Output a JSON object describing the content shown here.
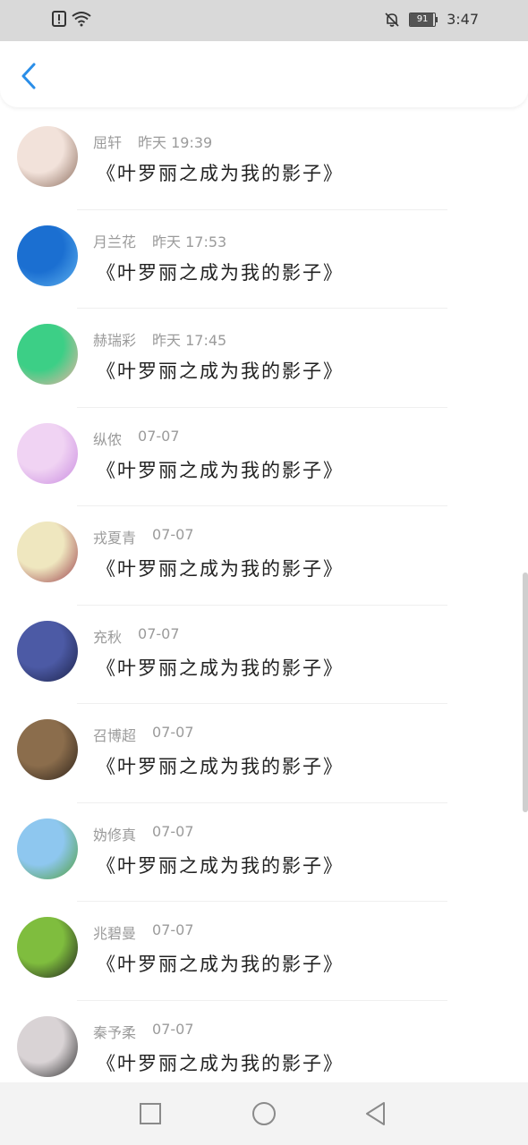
{
  "status_bar": {
    "time": "3:47",
    "battery": "91",
    "icons": [
      "alert-icon",
      "wifi-icon",
      "bell-off-icon",
      "battery-icon"
    ]
  },
  "header": {
    "back_icon": "chevron-left-icon",
    "accent": "#2a8ee8"
  },
  "items": [
    {
      "name": "屈轩",
      "time": "昨天 19:39",
      "message": "《叶罗丽之成为我的影子》",
      "avatar_colors": [
        "#f2e2da",
        "#8a6b5c"
      ]
    },
    {
      "name": "月兰花",
      "time": "昨天 17:53",
      "message": "《叶罗丽之成为我的影子》",
      "avatar_colors": [
        "#1b6fd1",
        "#5fb2ef"
      ]
    },
    {
      "name": "赫瑞彩",
      "time": "昨天 17:45",
      "message": "《叶罗丽之成为我的影子》",
      "avatar_colors": [
        "#3ccf86",
        "#f3b1a2"
      ]
    },
    {
      "name": "纵侬",
      "time": "07-07",
      "message": "《叶罗丽之成为我的影子》",
      "avatar_colors": [
        "#f0d3f3",
        "#c98ae0"
      ]
    },
    {
      "name": "戎夏青",
      "time": "07-07",
      "message": "《叶罗丽之成为我的影子》",
      "avatar_colors": [
        "#efe7bf",
        "#9a3d4a"
      ]
    },
    {
      "name": "充秋",
      "time": "07-07",
      "message": "《叶罗丽之成为我的影子》",
      "avatar_colors": [
        "#4c5aa5",
        "#1b2147"
      ]
    },
    {
      "name": "召博超",
      "time": "07-07",
      "message": "《叶罗丽之成为我的影子》",
      "avatar_colors": [
        "#8b6d4c",
        "#2b2018"
      ]
    },
    {
      "name": "妫修真",
      "time": "07-07",
      "message": "《叶罗丽之成为我的影子》",
      "avatar_colors": [
        "#8ec7ef",
        "#4f9e38"
      ]
    },
    {
      "name": "兆碧曼",
      "time": "07-07",
      "message": "《叶罗丽之成为我的影子》",
      "avatar_colors": [
        "#7fbd3e",
        "#1c1c1c"
      ]
    },
    {
      "name": "秦予柔",
      "time": "07-07",
      "message": "《叶罗丽之成为我的影子》",
      "avatar_colors": [
        "#d9d3d5",
        "#2a2a2a"
      ]
    }
  ],
  "nav": {
    "icons": [
      "recent-apps-square-icon",
      "home-circle-icon",
      "back-triangle-icon"
    ]
  }
}
